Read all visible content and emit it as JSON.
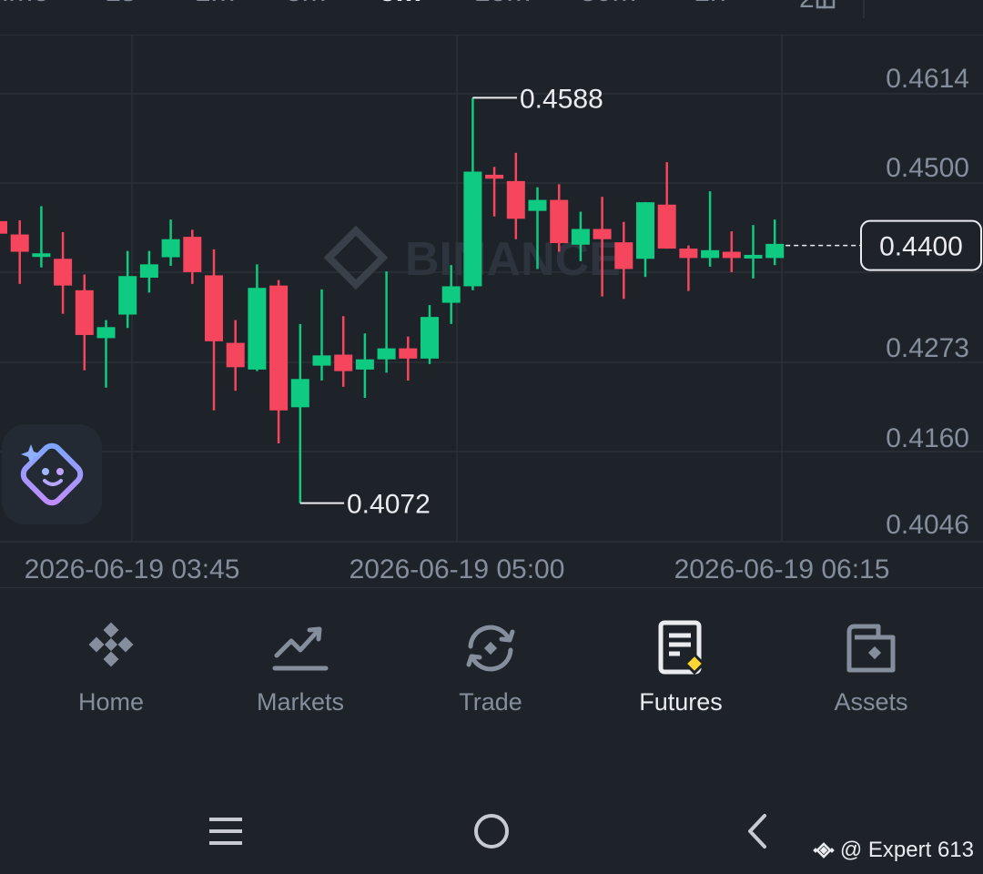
{
  "timeframes": [
    {
      "label": "ime",
      "active": false
    },
    {
      "label": "1s",
      "active": false
    },
    {
      "label": "1m",
      "active": false
    },
    {
      "label": "3m",
      "active": false
    },
    {
      "label": "5m",
      "active": true
    },
    {
      "label": "15m",
      "active": false
    },
    {
      "label": "30m",
      "active": false
    },
    {
      "label": "1h",
      "active": false
    }
  ],
  "layout_icon": "layout-grid-icon",
  "chart_data": {
    "type": "candlestick",
    "watermark_text": "BINANCE",
    "y_ticks": [
      "0.4614",
      "0.4500",
      "0.4273",
      "0.4160",
      "0.4046"
    ],
    "x_ticks": [
      "2026-06-19 03:45",
      "2026-06-19 05:00",
      "2026-06-19 06:15"
    ],
    "current_price": "0.4400",
    "high_label": "0.4588",
    "low_label": "0.4072",
    "candles": [
      {
        "o": 0.4431,
        "h": 0.4469,
        "l": 0.4399,
        "c": 0.4415
      },
      {
        "o": 0.4414,
        "h": 0.4432,
        "l": 0.4351,
        "c": 0.4392
      },
      {
        "o": 0.439,
        "h": 0.445,
        "l": 0.4372,
        "c": 0.439
      },
      {
        "o": 0.4383,
        "h": 0.4417,
        "l": 0.4313,
        "c": 0.4349
      },
      {
        "o": 0.4343,
        "h": 0.4363,
        "l": 0.4241,
        "c": 0.4286
      },
      {
        "o": 0.4282,
        "h": 0.4305,
        "l": 0.4219,
        "c": 0.4296
      },
      {
        "o": 0.4312,
        "h": 0.4393,
        "l": 0.4295,
        "c": 0.4361
      },
      {
        "o": 0.4359,
        "h": 0.4393,
        "l": 0.434,
        "c": 0.4376
      },
      {
        "o": 0.4385,
        "h": 0.4433,
        "l": 0.4374,
        "c": 0.4408
      },
      {
        "o": 0.4411,
        "h": 0.442,
        "l": 0.4351,
        "c": 0.4366
      },
      {
        "o": 0.4362,
        "h": 0.4395,
        "l": 0.419,
        "c": 0.4278
      },
      {
        "o": 0.4276,
        "h": 0.4305,
        "l": 0.4215,
        "c": 0.4245
      },
      {
        "o": 0.4242,
        "h": 0.4376,
        "l": 0.424,
        "c": 0.4346
      },
      {
        "o": 0.4349,
        "h": 0.4356,
        "l": 0.4148,
        "c": 0.419
      },
      {
        "o": 0.4194,
        "h": 0.43,
        "l": 0.4072,
        "c": 0.423
      },
      {
        "o": 0.4247,
        "h": 0.4344,
        "l": 0.4228,
        "c": 0.426
      },
      {
        "o": 0.4261,
        "h": 0.431,
        "l": 0.422,
        "c": 0.424
      },
      {
        "o": 0.4242,
        "h": 0.4288,
        "l": 0.4206,
        "c": 0.4255
      },
      {
        "o": 0.4255,
        "h": 0.4367,
        "l": 0.4238,
        "c": 0.4269
      },
      {
        "o": 0.4269,
        "h": 0.4284,
        "l": 0.4228,
        "c": 0.4256
      },
      {
        "o": 0.4256,
        "h": 0.4324,
        "l": 0.4249,
        "c": 0.4309
      },
      {
        "o": 0.4327,
        "h": 0.4375,
        "l": 0.43,
        "c": 0.4348
      },
      {
        "o": 0.4348,
        "h": 0.4588,
        "l": 0.4343,
        "c": 0.4494
      },
      {
        "o": 0.449,
        "h": 0.45,
        "l": 0.4437,
        "c": 0.4485
      },
      {
        "o": 0.4482,
        "h": 0.4518,
        "l": 0.4408,
        "c": 0.4434
      },
      {
        "o": 0.4444,
        "h": 0.4474,
        "l": 0.437,
        "c": 0.4458
      },
      {
        "o": 0.4458,
        "h": 0.4478,
        "l": 0.4392,
        "c": 0.4403
      },
      {
        "o": 0.4401,
        "h": 0.4443,
        "l": 0.438,
        "c": 0.4421
      },
      {
        "o": 0.4421,
        "h": 0.4462,
        "l": 0.4335,
        "c": 0.4408
      },
      {
        "o": 0.4404,
        "h": 0.443,
        "l": 0.4332,
        "c": 0.437
      },
      {
        "o": 0.4383,
        "h": 0.4455,
        "l": 0.436,
        "c": 0.4455
      },
      {
        "o": 0.4452,
        "h": 0.4506,
        "l": 0.4396,
        "c": 0.4396
      },
      {
        "o": 0.4396,
        "h": 0.44,
        "l": 0.4342,
        "c": 0.4384
      },
      {
        "o": 0.4384,
        "h": 0.4469,
        "l": 0.4373,
        "c": 0.4394
      },
      {
        "o": 0.4392,
        "h": 0.4418,
        "l": 0.4366,
        "c": 0.4384
      },
      {
        "o": 0.4386,
        "h": 0.4426,
        "l": 0.4358,
        "c": 0.4388
      },
      {
        "o": 0.4384,
        "h": 0.4433,
        "l": 0.4375,
        "c": 0.4402
      }
    ]
  },
  "colors": {
    "bg": "#1e2329",
    "up": "#0ecb81",
    "down": "#f6465d",
    "grid": "#2b3139",
    "axis_text": "#848e9c",
    "text": "#eaecef",
    "accent": "#fcd535"
  },
  "ai_assistant": {
    "icon": "ai-assistant-icon"
  },
  "nav": {
    "items": [
      {
        "label": "Home",
        "icon": "binance-logo-icon",
        "active": false
      },
      {
        "label": "Markets",
        "icon": "chart-trend-icon",
        "active": false
      },
      {
        "label": "Trade",
        "icon": "trade-swap-icon",
        "active": false
      },
      {
        "label": "Futures",
        "icon": "futures-document-icon",
        "active": true
      },
      {
        "label": "Assets",
        "icon": "wallet-icon",
        "active": false
      }
    ]
  },
  "system_nav": {
    "recents": "menu-icon",
    "home": "home-circle-icon",
    "back": "back-arrow-icon"
  },
  "watermark": {
    "text": "@ Expert 613"
  }
}
